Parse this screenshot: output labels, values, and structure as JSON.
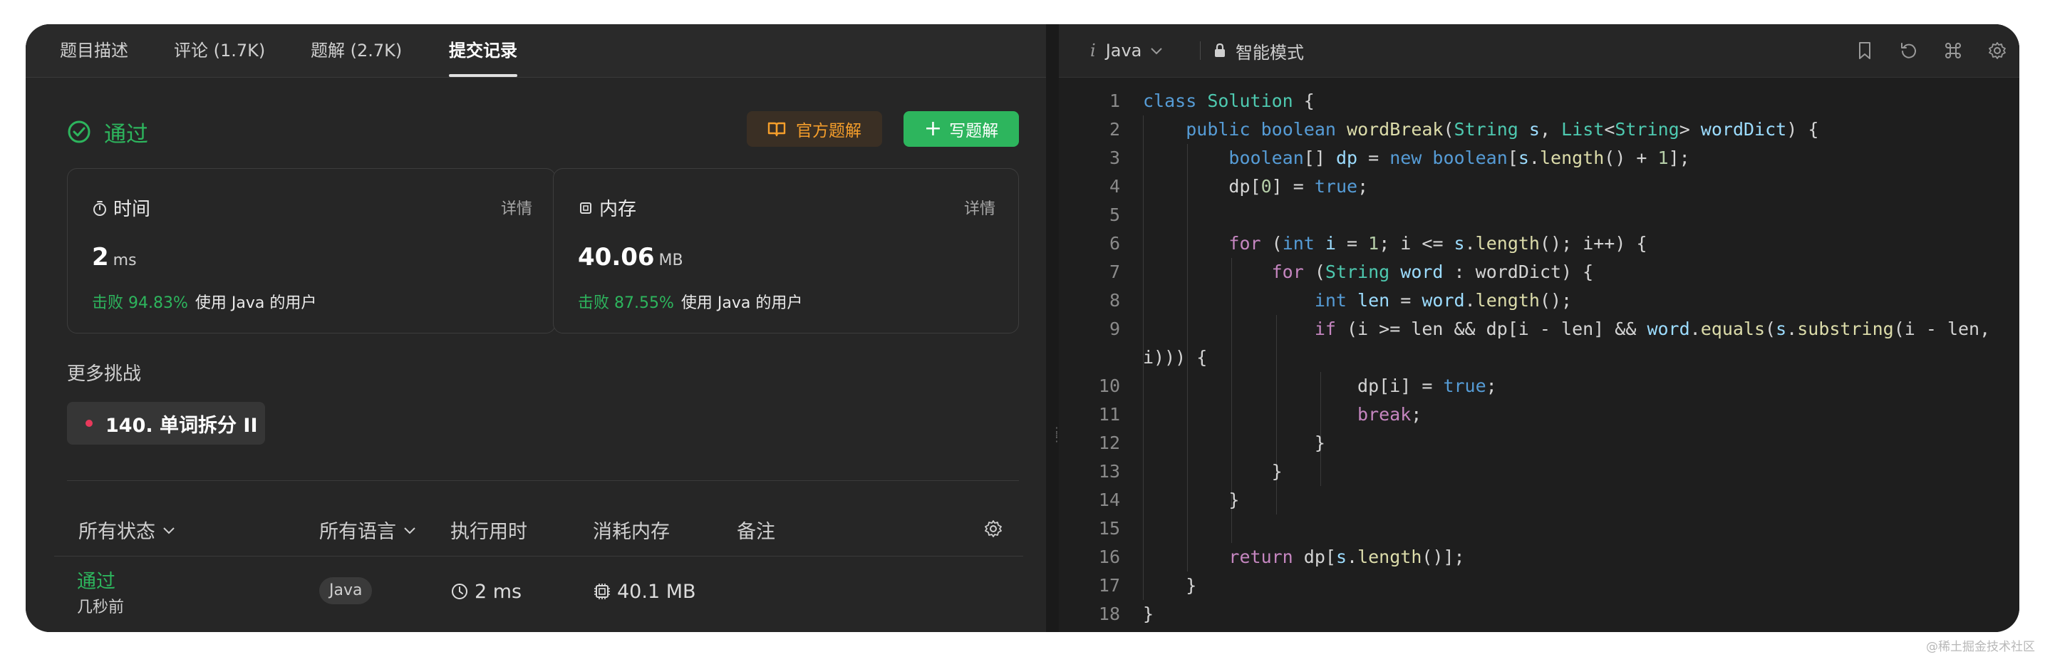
{
  "tabs": [
    "题目描述",
    "评论 (1.7K)",
    "题解 (2.7K)",
    "提交记录"
  ],
  "status": "通过",
  "buttons": {
    "official": "官方题解",
    "write": "写题解"
  },
  "runtime_card": {
    "title": "时间",
    "detail": "详情",
    "value": "2",
    "unit": "ms",
    "beat": "击败 94.83%",
    "suffix": "使用 Java 的用户"
  },
  "memory_card": {
    "title": "内存",
    "detail": "详情",
    "value": "40.06",
    "unit": "MB",
    "beat": "击败 87.55%",
    "suffix": "使用 Java 的用户"
  },
  "more_challenges": {
    "title": "更多挑战",
    "items": [
      "140. 单词拆分 II"
    ]
  },
  "table": {
    "headers": [
      "所有状态",
      "所有语言",
      "执行用时",
      "消耗内存",
      "备注"
    ],
    "rows": [
      {
        "status": "通过",
        "time": "几秒前",
        "lang": "Java",
        "runtime": "2 ms",
        "memory": "40.1 MB"
      }
    ]
  },
  "editor": {
    "language": "Java",
    "language_prefix": "i",
    "mode": "智能模式",
    "line_numbers": [
      "1",
      "2",
      "3",
      "4",
      "5",
      "6",
      "7",
      "8",
      "9",
      "",
      "10",
      "11",
      "12",
      "13",
      "14",
      "15",
      "16",
      "17",
      "18"
    ]
  },
  "icons": [
    "check-circle-icon",
    "book-icon",
    "plus-icon",
    "stopwatch-icon",
    "chip-icon",
    "chevron-down-icon",
    "gear-icon",
    "clock-icon",
    "lock-icon",
    "bookmark-icon",
    "reset-icon",
    "command-icon"
  ],
  "colors": {
    "accent_green": "#2db55d",
    "accent_orange": "#f59e2b",
    "challenge_dot": "#e8395b"
  },
  "watermark": "@稀土掘金技术社区"
}
